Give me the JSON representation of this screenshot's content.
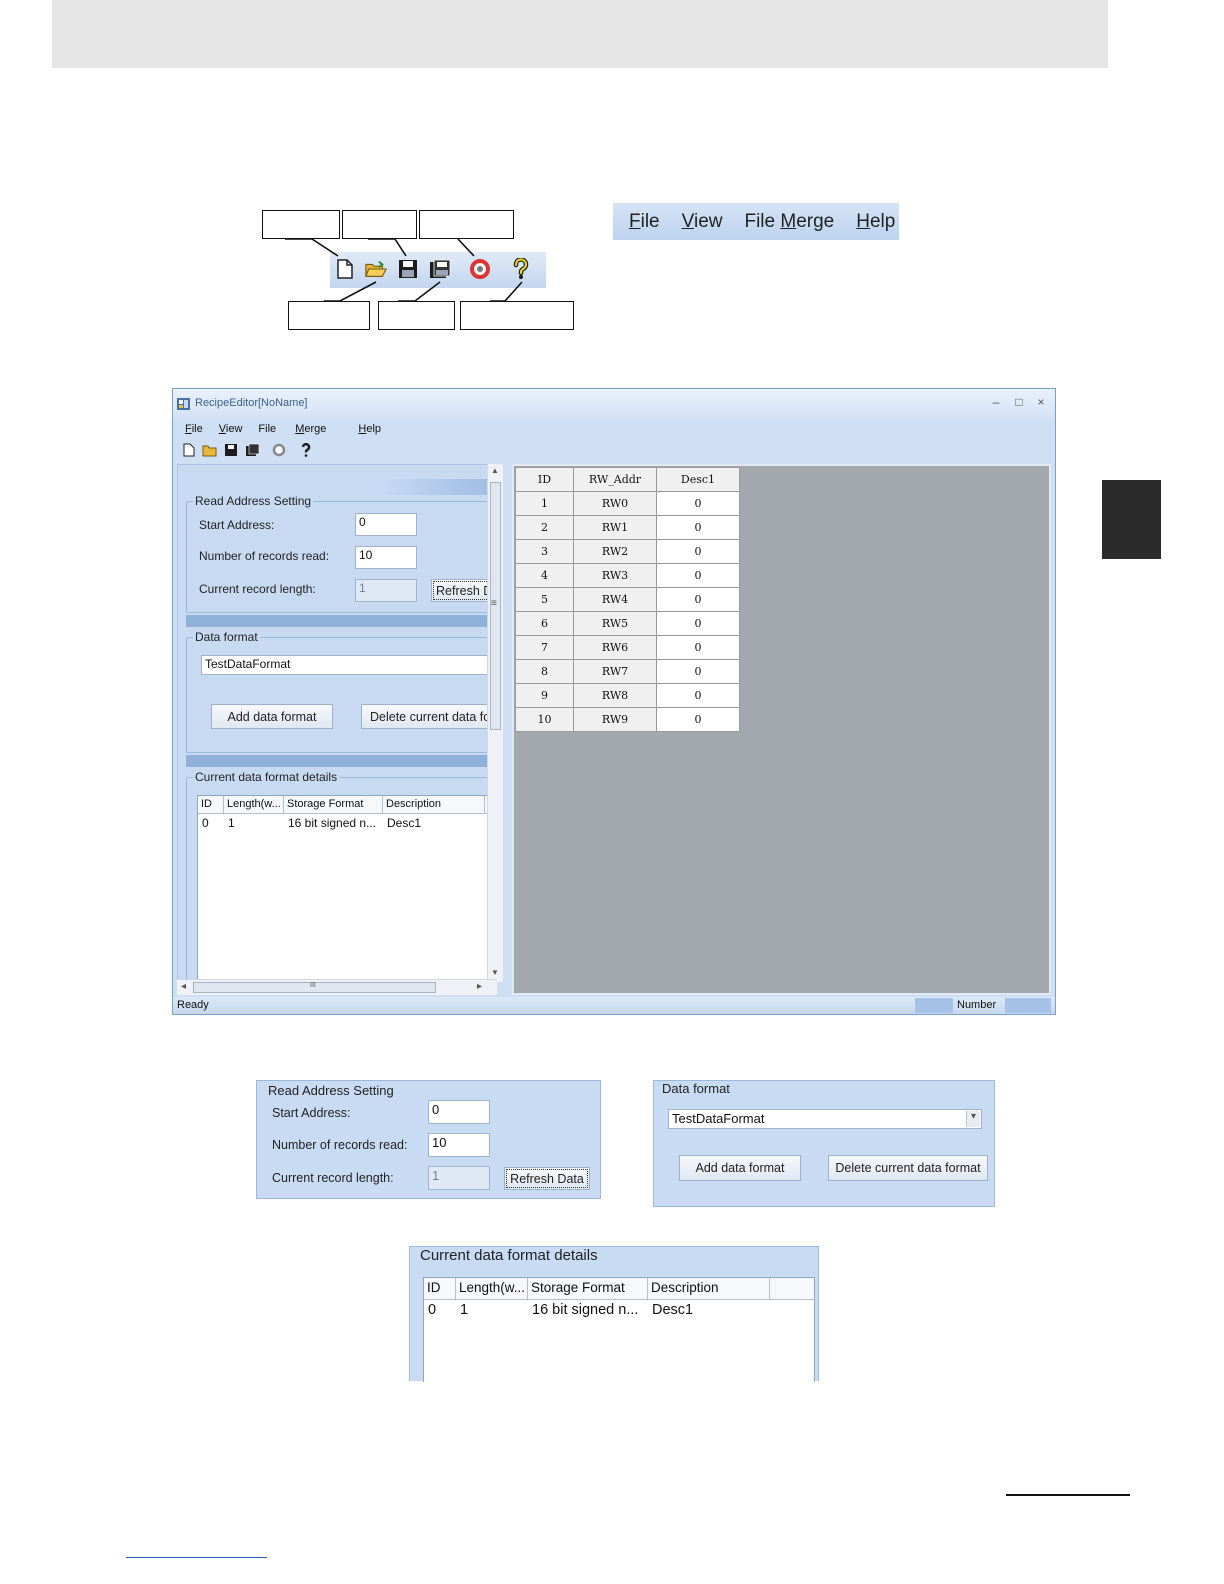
{
  "toolbar_icons": [
    {
      "icon": "new-file-icon",
      "glyph": "🗋"
    },
    {
      "icon": "open-folder-icon",
      "glyph": "📂"
    },
    {
      "icon": "save-icon",
      "glyph": "💾"
    },
    {
      "icon": "save-as-icon",
      "glyph": "🖫"
    },
    {
      "icon": "connect-icon",
      "glyph": "⏺"
    },
    {
      "icon": "help-icon",
      "glyph": "?"
    }
  ],
  "menu": {
    "file": "File",
    "file_key": "F",
    "view": "View",
    "view_key": "V",
    "file_merge_pre": "File ",
    "file_merge_key": "M",
    "file_merge_post": "erge",
    "help": "Help",
    "help_key": "H"
  },
  "window": {
    "title": "RecipeEditor[NoName]",
    "minimize": "–",
    "maximize": "□",
    "close": "×"
  },
  "read_address": {
    "legend": "Read Address Setting",
    "start_address_label": "Start Address:",
    "start_address_value": "0",
    "records_label": "Number of records read:",
    "records_value": "10",
    "record_length_label": "Current record length:",
    "record_length_value": "1",
    "refresh_button": "Refresh Data"
  },
  "data_format": {
    "legend": "Data format",
    "selected": "TestDataFormat",
    "add_button": "Add data format",
    "delete_button": "Delete current data format"
  },
  "details": {
    "legend": "Current data format details",
    "columns": [
      "ID",
      "Length(w...",
      "Storage Format",
      "Description"
    ],
    "rows": [
      [
        "0",
        "1",
        "16 bit signed n...",
        "Desc1"
      ]
    ]
  },
  "grid": {
    "headers": [
      "ID",
      "RW_Addr",
      "Desc1"
    ],
    "rows": [
      [
        "1",
        "RW0",
        "0"
      ],
      [
        "2",
        "RW1",
        "0"
      ],
      [
        "3",
        "RW2",
        "0"
      ],
      [
        "4",
        "RW3",
        "0"
      ],
      [
        "5",
        "RW4",
        "0"
      ],
      [
        "6",
        "RW5",
        "0"
      ],
      [
        "7",
        "RW6",
        "0"
      ],
      [
        "8",
        "RW7",
        "0"
      ],
      [
        "9",
        "RW8",
        "0"
      ],
      [
        "10",
        "RW9",
        "0"
      ]
    ]
  },
  "status": {
    "ready": "Ready",
    "number": "Number"
  },
  "scroll_glyphs": {
    "up": "▲",
    "down": "▼",
    "left": "◂",
    "right": "▸",
    "grip": "≡",
    "hgrip": "III",
    "dropdown": "▾"
  }
}
